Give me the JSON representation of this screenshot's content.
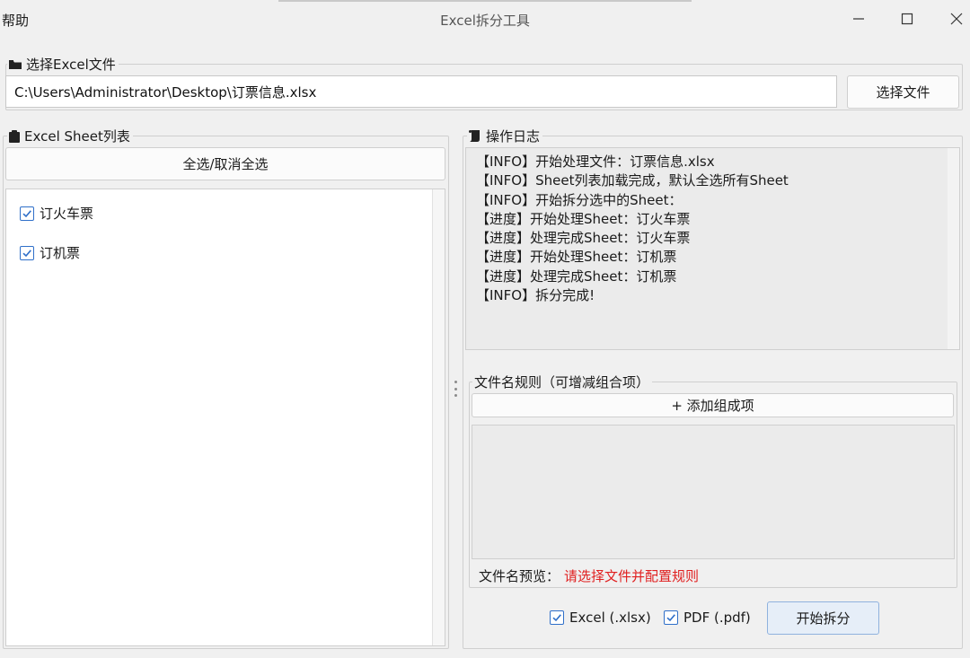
{
  "window": {
    "menu_help": "帮助",
    "title": "Excel拆分工具"
  },
  "file_group": {
    "legend": "选择Excel文件",
    "path_value": "C:\\Users\\Administrator\\Desktop\\订票信息.xlsx",
    "select_button": "选择文件"
  },
  "sheets_group": {
    "legend": "Excel Sheet列表",
    "select_all_button": "全选/取消全选",
    "items": [
      {
        "label": "订火车票",
        "checked": true
      },
      {
        "label": "订机票",
        "checked": true
      }
    ]
  },
  "log_group": {
    "legend": "操作日志",
    "lines": [
      "【INFO】开始处理文件：订票信息.xlsx",
      "【INFO】Sheet列表加载完成，默认全选所有Sheet",
      "【INFO】开始拆分选中的Sheet：",
      "【进度】开始处理Sheet：订火车票",
      "【进度】处理完成Sheet：订火车票",
      "【进度】开始处理Sheet：订机票",
      "【进度】处理完成Sheet：订机票",
      "【INFO】拆分完成!"
    ]
  },
  "rules_group": {
    "legend": "文件名规则（可增减组合项）",
    "add_button": "+ 添加组成项",
    "preview_label": "文件名预览：",
    "preview_value": "请选择文件并配置规则"
  },
  "output": {
    "excel_label": "Excel (.xlsx)",
    "excel_checked": true,
    "pdf_label": "PDF (.pdf)",
    "pdf_checked": true,
    "start_button": "开始拆分"
  },
  "colors": {
    "accent": "#2f6fc9",
    "error_text": "#e02020"
  }
}
